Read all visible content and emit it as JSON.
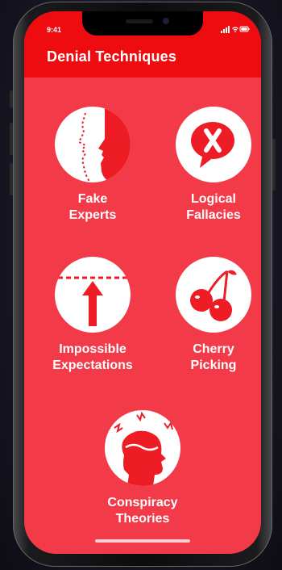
{
  "status_bar": {
    "time": "9:41"
  },
  "header": {
    "title": "Denial Techniques"
  },
  "techniques": [
    {
      "line1": "Fake",
      "line2": "Experts",
      "icon": "fake-experts-icon"
    },
    {
      "line1": "Logical",
      "line2": "Fallacies",
      "icon": "logical-fallacies-icon"
    },
    {
      "line1": "Impossible",
      "line2": "Expectations",
      "icon": "impossible-expectations-icon"
    },
    {
      "line1": "Cherry",
      "line2": "Picking",
      "icon": "cherry-picking-icon"
    },
    {
      "line1": "Conspiracy",
      "line2": "Theories",
      "icon": "conspiracy-theories-icon"
    }
  ],
  "colors": {
    "header": "#ee0c10",
    "background": "#f23a48",
    "icon_fill": "#ee1c24",
    "circle": "#ffffff"
  }
}
